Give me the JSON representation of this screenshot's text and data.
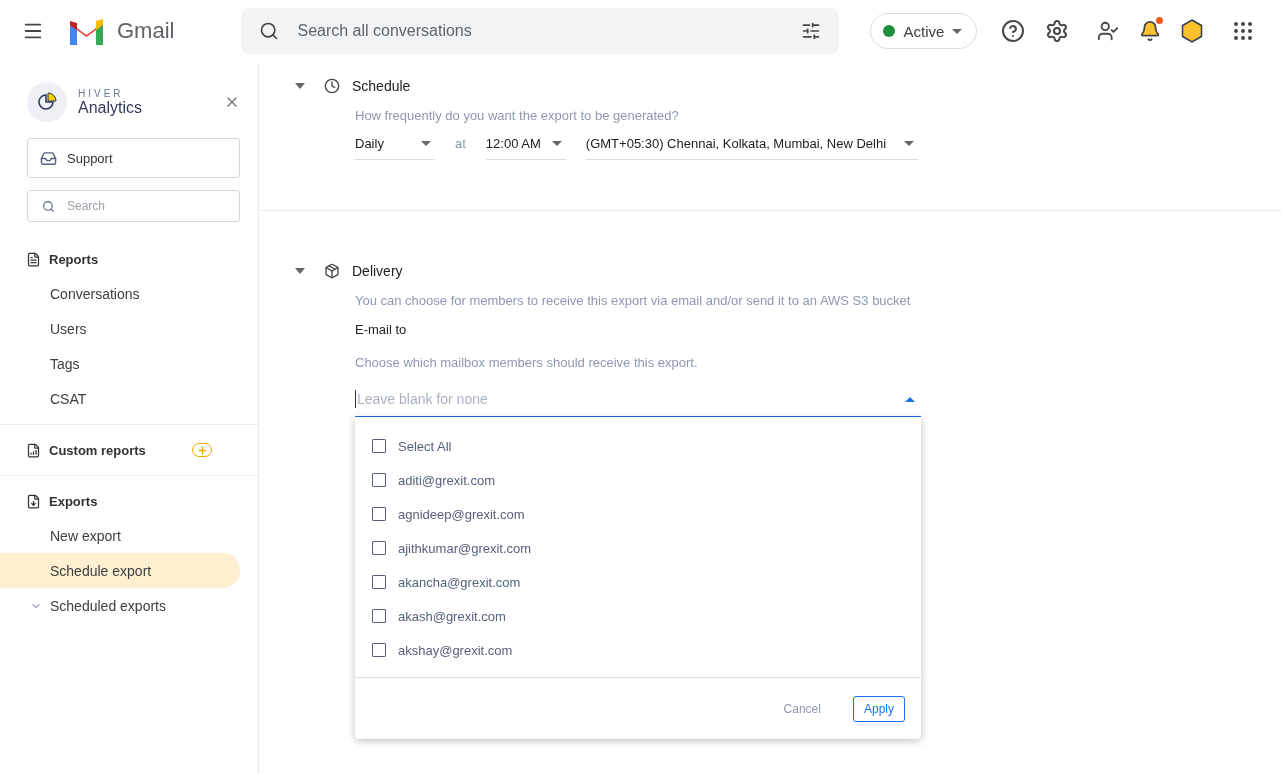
{
  "topbar": {
    "app_name": "Gmail",
    "search": {
      "placeholder": "Search all conversations"
    },
    "status": {
      "label": "Active",
      "color": "#1e8e3e"
    },
    "notifications_unread": true
  },
  "sidebar": {
    "brand": {
      "overline": "HIVER",
      "title": "Analytics"
    },
    "workspace": "Support",
    "search": {
      "placeholder": "Search"
    },
    "sections": [
      {
        "title": "Reports",
        "addable": false,
        "items": [
          {
            "label": "Conversations",
            "selected": false,
            "kind": "link"
          },
          {
            "label": "Users",
            "selected": false,
            "kind": "link"
          },
          {
            "label": "Tags",
            "selected": false,
            "kind": "link"
          },
          {
            "label": "CSAT",
            "selected": false,
            "kind": "link"
          }
        ]
      },
      {
        "title": "Custom reports",
        "addable": true
      },
      {
        "title": "Exports",
        "addable": false,
        "items": [
          {
            "label": "New export",
            "selected": false,
            "kind": "link"
          },
          {
            "label": "Schedule export",
            "selected": true,
            "kind": "link"
          },
          {
            "label": "Scheduled exports",
            "selected": false,
            "kind": "expandable"
          }
        ]
      }
    ]
  },
  "schedule": {
    "title": "Schedule",
    "expanded": true,
    "hint": "How frequently do you want the export to be generated?",
    "frequency": "Daily",
    "at": "at",
    "time": "12:00 AM",
    "timezone": "(GMT+05:30) Chennai, Kolkata, Mumbai, New Delhi"
  },
  "delivery": {
    "title": "Delivery",
    "expanded": true,
    "hint": "You can choose for members to receive this export via email and/or send it to an AWS S3 bucket",
    "email_label": "E-mail to",
    "email_hint": "Choose which mailbox members should receive this export.",
    "recipients": {
      "placeholder": "Leave blank for none",
      "open": true,
      "options": [
        {
          "label": "Select All",
          "checked": false
        },
        {
          "label": "aditi@grexit.com",
          "checked": false
        },
        {
          "label": "agnideep@grexit.com",
          "checked": false
        },
        {
          "label": "ajithkumar@grexit.com",
          "checked": false
        },
        {
          "label": "akancha@grexit.com",
          "checked": false
        },
        {
          "label": "akash@grexit.com",
          "checked": false
        },
        {
          "label": "akshay@grexit.com",
          "checked": false
        }
      ],
      "buttons": {
        "cancel": "Cancel",
        "apply": "Apply"
      }
    }
  }
}
